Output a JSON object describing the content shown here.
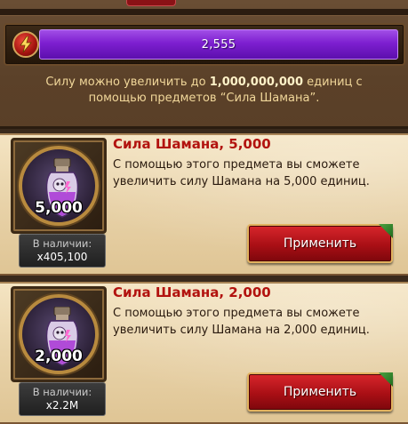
{
  "power": {
    "value": "2,555",
    "icon": "lightning-icon",
    "color": "#7d1fd0"
  },
  "info": {
    "line1_prefix": "Силу можно увеличить до",
    "line1_amount": "1,000,000,000",
    "line1_suffix": "единиц с",
    "line2": "помощью предметов “Сила Шамана”."
  },
  "items": [
    {
      "title": "Сила Шамана, 5,000",
      "description": "С помощью этого предмета вы сможете увеличить силу Шамана на 5,000 единиц.",
      "amount": "5,000",
      "stock_label": "В наличии:",
      "stock_value": "x405,100",
      "button_label": "Применить",
      "icon": "shaman-potion-icon"
    },
    {
      "title": "Сила Шамана, 2,000",
      "description": "С помощью этого предмета вы сможете увеличить силу Шамана на 2,000 единиц.",
      "amount": "2,000",
      "stock_label": "В наличии:",
      "stock_value": "x2.2M",
      "button_label": "Применить",
      "icon": "shaman-potion-icon"
    }
  ],
  "colors": {
    "title": "#b2130f",
    "button": "#a90f15",
    "bar": "#7d1fd0"
  }
}
